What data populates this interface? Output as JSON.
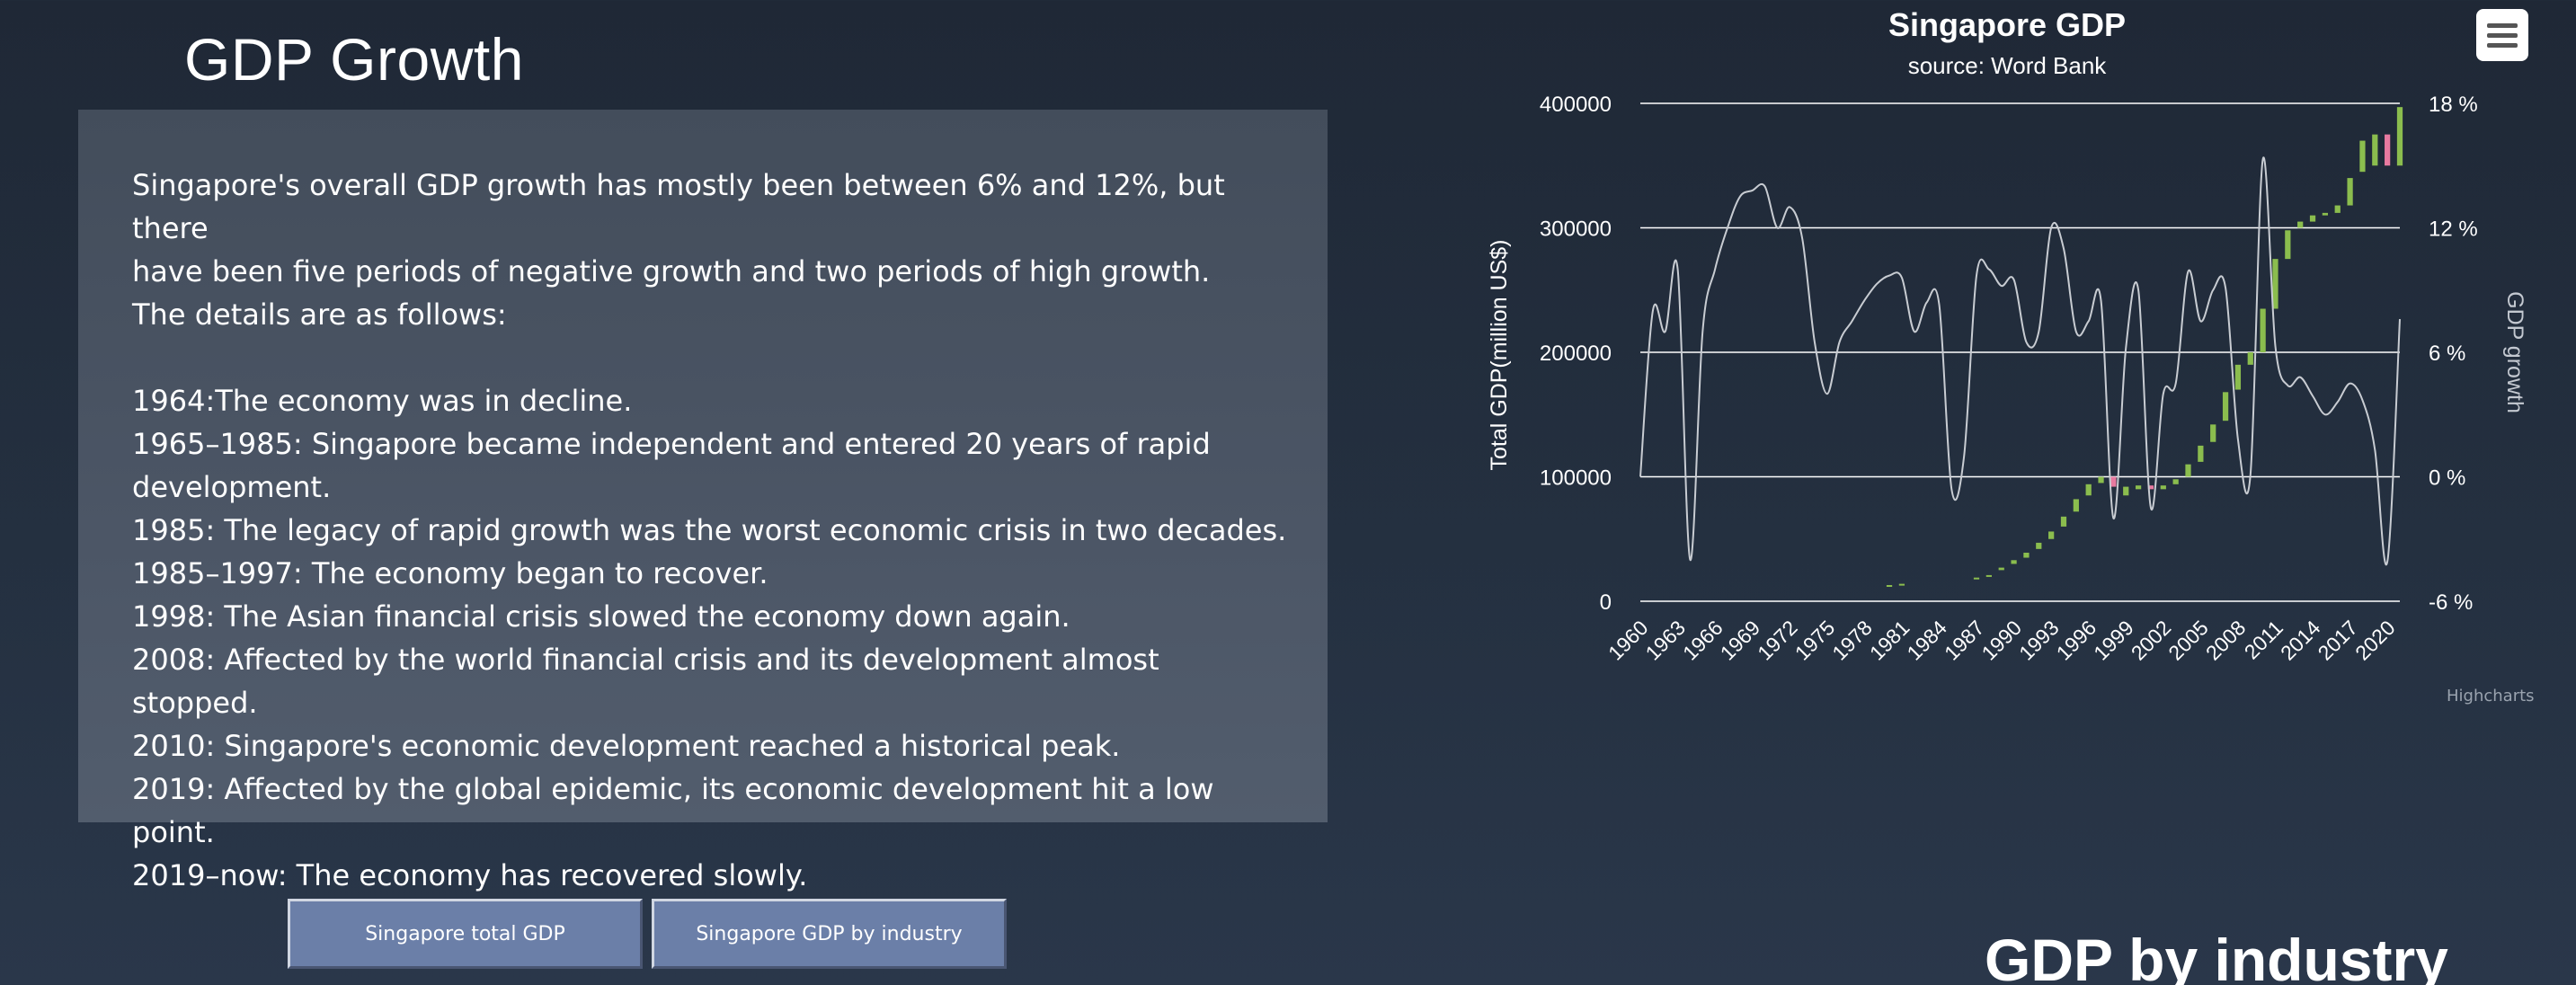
{
  "page": {
    "title": "GDP Growth",
    "section_title": "GDP by industry"
  },
  "panel": {
    "intro_lines": [
      "Singapore's overall GDP growth has mostly been between 6% and 12%, but there",
      "have been five periods of negative growth and two periods of high growth.",
      "The details are as follows:"
    ],
    "details": [
      "1964:The economy was in decline.",
      "1965–1985: Singapore became independent and entered 20 years of rapid",
      "development.",
      "1985: The legacy of rapid growth was the worst economic crisis in two decades.",
      "1985–1997: The economy began to recover.",
      "1998: The Asian financial crisis slowed the economy down again.",
      "2008: Affected by the world financial crisis and its development almost stopped.",
      "2010: Singapore's economic development reached a historical peak.",
      "2019: Affected by the global epidemic, its economic development hit a low point.",
      "2019–now: The economy has recovered slowly."
    ]
  },
  "buttons": {
    "total_gdp": "Singapore total GDP",
    "gdp_by_industry": "Singapore GDP by industry"
  },
  "chart_menu_icon": "hamburger-menu-icon",
  "credits": "Highcharts",
  "colors": {
    "up": "#8bbd4e",
    "down": "#e87aa0",
    "growth_line": "#c8ccd2",
    "grid": "#ffffff"
  },
  "chart_data": {
    "type": "candlestick+line",
    "title": "Singapore GDP",
    "subtitle": "source: Word Bank",
    "ylabel_left": "Total GDP(million US$)",
    "ylabel_right": "GDP growth",
    "left_ticks": [
      "0",
      "100000",
      "200000",
      "300000",
      "400000"
    ],
    "right_ticks": [
      "-6 %",
      "0 %",
      "6 %",
      "12 %",
      "18 %"
    ],
    "ylim_left": [
      0,
      400000
    ],
    "ylim_right": [
      -6,
      18
    ],
    "x_tick_labels": [
      "1960",
      "1963",
      "1966",
      "1969",
      "1972",
      "1975",
      "1978",
      "1981",
      "1984",
      "1987",
      "1990",
      "1993",
      "1996",
      "1999",
      "2002",
      "2005",
      "2008",
      "2011",
      "2014",
      "2017",
      "2020"
    ],
    "grid": true,
    "years": [
      1960,
      1961,
      1962,
      1963,
      1964,
      1965,
      1966,
      1967,
      1968,
      1969,
      1970,
      1971,
      1972,
      1973,
      1974,
      1975,
      1976,
      1977,
      1978,
      1979,
      1980,
      1981,
      1982,
      1983,
      1984,
      1985,
      1986,
      1987,
      1988,
      1989,
      1990,
      1991,
      1992,
      1993,
      1994,
      1995,
      1996,
      1997,
      1998,
      1999,
      2000,
      2001,
      2002,
      2003,
      2004,
      2005,
      2006,
      2007,
      2008,
      2009,
      2010,
      2011,
      2012,
      2013,
      2014,
      2015,
      2016,
      2017,
      2018,
      2019,
      2020,
      2021
    ],
    "gdp_open": [
      0,
      0,
      0,
      0,
      0,
      0,
      0,
      0,
      0,
      0,
      0,
      0,
      0,
      0,
      0,
      0,
      0,
      0,
      0,
      0,
      12000,
      13500,
      0,
      0,
      0,
      0,
      0,
      18000,
      20000,
      25000,
      30000,
      35000,
      42000,
      50000,
      60000,
      72000,
      85000,
      95000,
      100000,
      85000,
      90000,
      93000,
      90000,
      94000,
      100000,
      112000,
      128000,
      145000,
      170000,
      190000,
      200000,
      235000,
      275000,
      300000,
      305000,
      310000,
      312000,
      318000,
      345000,
      350000,
      375000,
      350000
    ],
    "gdp_close": [
      0,
      0,
      0,
      0,
      0,
      0,
      0,
      0,
      0,
      0,
      0,
      0,
      0,
      0,
      0,
      0,
      0,
      0,
      0,
      0,
      13000,
      14000,
      0,
      0,
      0,
      0,
      0,
      19000,
      21000,
      27000,
      33000,
      39000,
      47000,
      56000,
      68000,
      82000,
      94000,
      100000,
      92000,
      92000,
      93000,
      90000,
      93000,
      98000,
      110000,
      125000,
      142000,
      168000,
      190000,
      200000,
      235000,
      275000,
      298000,
      305000,
      310000,
      312000,
      318000,
      340000,
      370000,
      375000,
      350000,
      397000
    ],
    "gdp_direction": [
      "up",
      "up",
      "up",
      "up",
      "up",
      "up",
      "up",
      "up",
      "up",
      "up",
      "up",
      "up",
      "up",
      "up",
      "up",
      "up",
      "up",
      "up",
      "up",
      "up",
      "up",
      "up",
      "up",
      "up",
      "up",
      "up",
      "up",
      "up",
      "up",
      "up",
      "up",
      "up",
      "up",
      "up",
      "up",
      "up",
      "up",
      "up",
      "down",
      "up",
      "up",
      "down",
      "up",
      "up",
      "up",
      "up",
      "up",
      "up",
      "up",
      "up",
      "up",
      "up",
      "up",
      "up",
      "up",
      "up",
      "up",
      "up",
      "up",
      "up",
      "down",
      "up"
    ],
    "growth": [
      0,
      8,
      7,
      10,
      -4,
      7,
      10,
      12,
      13.5,
      13.8,
      14,
      12,
      13,
      11.5,
      6.5,
      4,
      6.5,
      7.5,
      8.5,
      9.3,
      9.7,
      9.6,
      7,
      8.4,
      8.3,
      -0.6,
      1,
      9.7,
      10,
      9.2,
      9.5,
      6.5,
      7,
      12,
      11,
      7,
      7.5,
      8.5,
      -2,
      6.2,
      9,
      -1.5,
      4,
      4.5,
      9.9,
      7.5,
      9,
      9.1,
      1.8,
      0.1,
      15.3,
      6.3,
      4.4,
      4.8,
      3.9,
      3,
      3.6,
      4.5,
      3.7,
      1.3,
      -4.1,
      7.6
    ]
  }
}
